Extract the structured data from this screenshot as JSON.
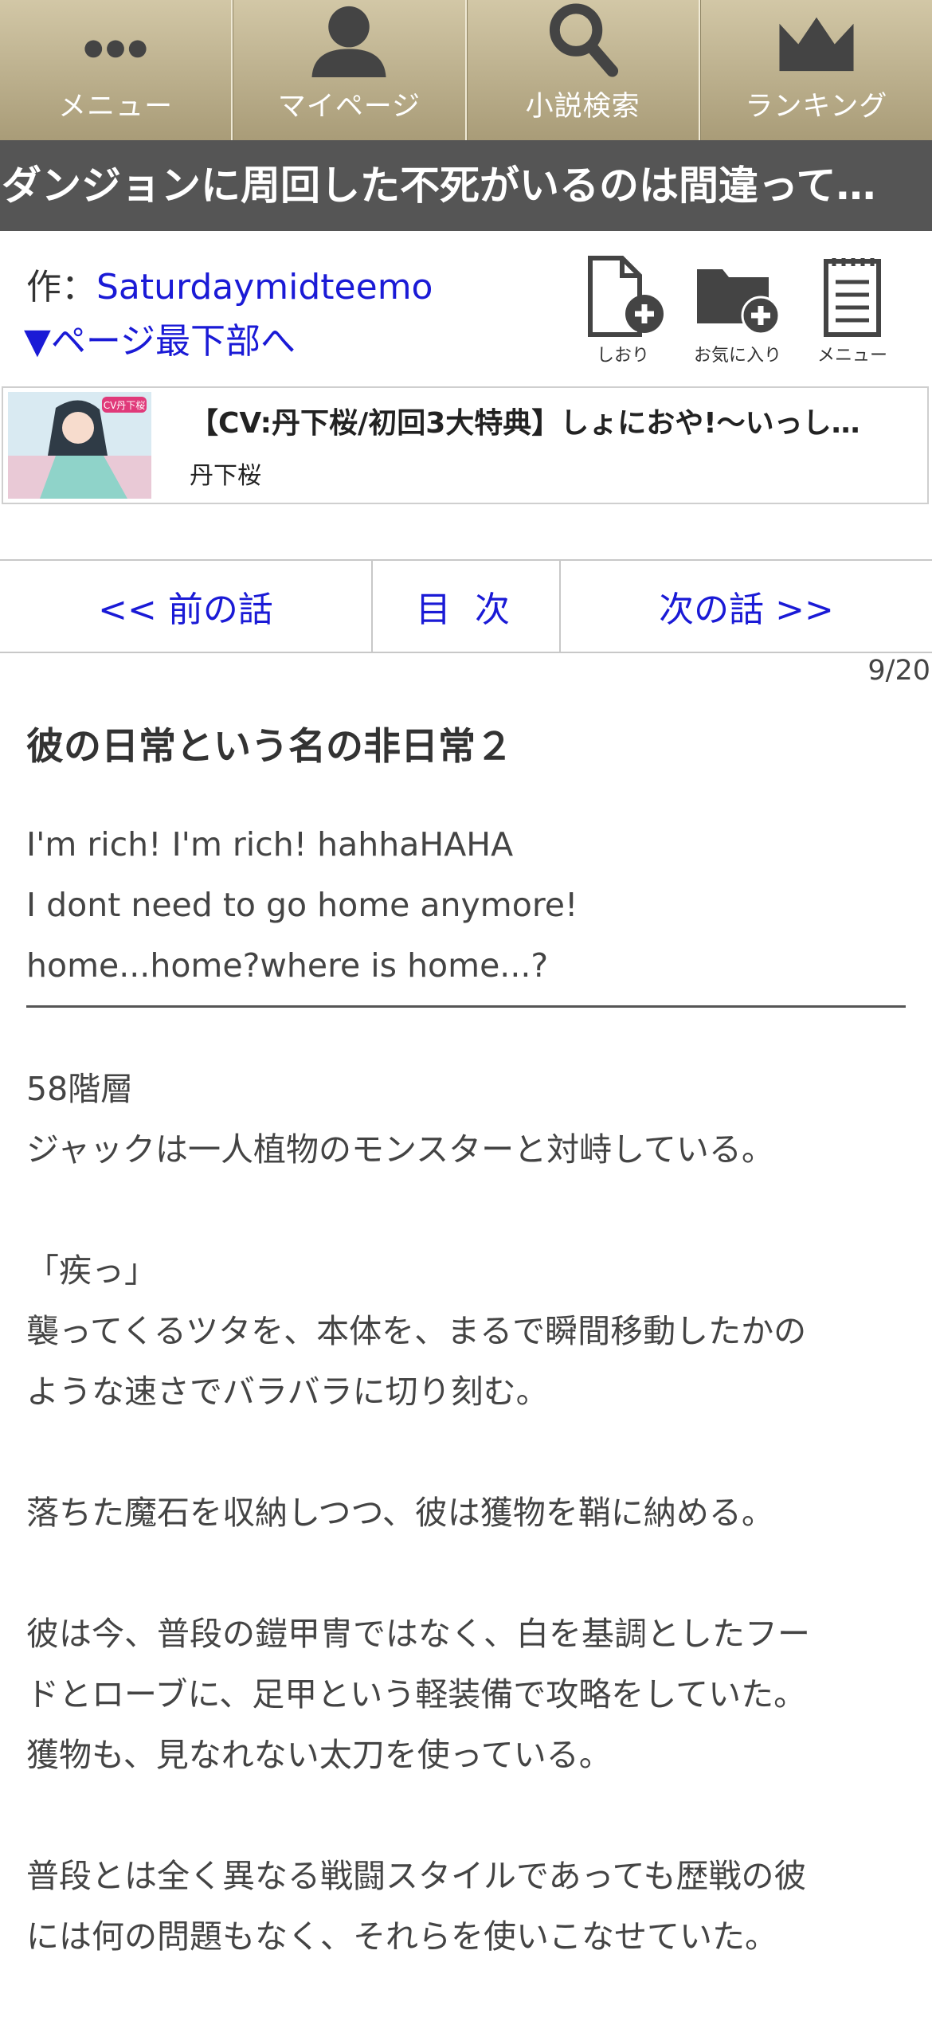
{
  "nav": {
    "items": [
      {
        "label": "メニュー",
        "icon": "dots-menu-icon"
      },
      {
        "label": "マイページ",
        "icon": "user-icon"
      },
      {
        "label": "小説検索",
        "icon": "search-icon"
      },
      {
        "label": "ランキング",
        "icon": "crown-icon"
      }
    ],
    "background": "#bdb28f"
  },
  "novel": {
    "title": "ダンジョンに周回した不死がいるのは間違って…",
    "author_prefix": "作：",
    "author": "Saturdaymidteemo",
    "to_bottom": "▼ページ最下部へ"
  },
  "tools": [
    {
      "label": "しおり",
      "icon": "bookmark-add-icon"
    },
    {
      "label": "お気に入り",
      "icon": "folder-add-icon"
    },
    {
      "label": "メニュー",
      "icon": "notepad-menu-icon"
    }
  ],
  "ad": {
    "title": "【CV:丹下桜/初回3大特典】しょにおや!～いっし…",
    "subtitle": "丹下桜",
    "thumb_badge": "CV丹下桜"
  },
  "pager": {
    "prev": "<< 前の話",
    "toc": "目 次",
    "next": "次の話 >>"
  },
  "episode_count": "9/20",
  "chapter": {
    "title": "彼の日常という名の非日常２",
    "preface": [
      "I'm rich! I'm rich! hahhaHAHA",
      "I dont need to go home anymore!",
      "home...home?where is home...?"
    ],
    "body": [
      "58階層",
      "ジャックは一人植物のモンスターと対峙している。",
      "",
      "「疾っ」",
      "襲ってくるツタを、本体を、まるで瞬間移動したかの",
      "ような速さでバラバラに切り刻む。",
      "",
      "落ちた魔石を収納しつつ、彼は獲物を鞘に納める。",
      "",
      "彼は今、普段の鎧甲冑ではなく、白を基調としたフー",
      "ドとローブに、足甲という軽装備で攻略をしていた。",
      "獲物も、見なれない太刀を使っている。",
      "",
      "普段とは全く異なる戦闘スタイルであっても歴戦の彼",
      "には何の問題もなく、それらを使いこなせていた。"
    ]
  }
}
